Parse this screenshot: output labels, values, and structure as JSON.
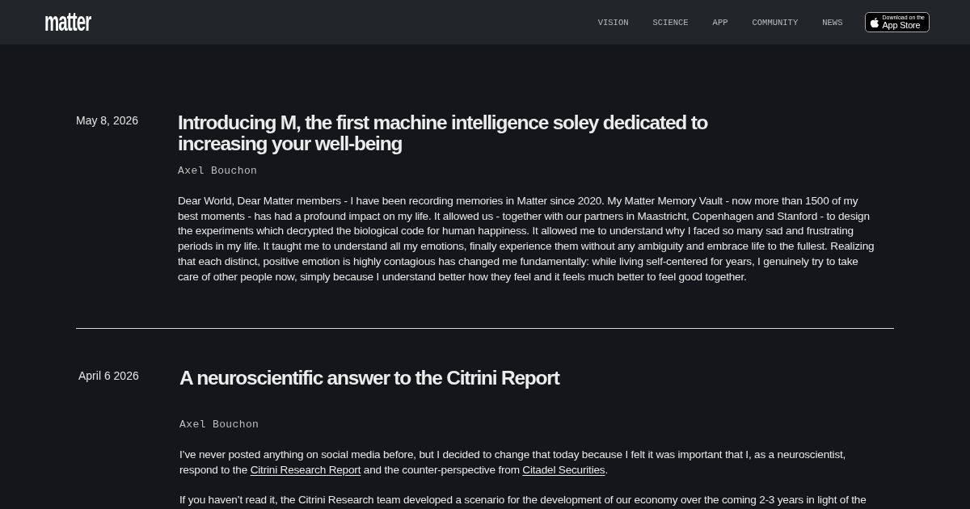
{
  "header": {
    "logo": "matter",
    "nav": [
      {
        "label": "VISION"
      },
      {
        "label": "SCIENCE"
      },
      {
        "label": "APP"
      },
      {
        "label": "COMMUNITY"
      },
      {
        "label": "NEWS"
      }
    ],
    "app_store_badge": {
      "small_text": "Download on the",
      "large_text": "App Store"
    }
  },
  "articles": [
    {
      "date": "May 8, 2026",
      "title": "Introducing M, the first machine intelligence soley dedicated to increasing your well-being",
      "author": "Axel Bouchon",
      "paragraphs": [
        {
          "segments": [
            {
              "kind": "text",
              "text": "Dear World, Dear Matter members -  I have been recording memories in Matter since 2020. My Matter Memory Vault - now more than 1500 of my best moments - has had a profound impact on my life. It allowed us -  together with our partners in Maastricht, Copenhagen and Stanford - to design the experiments which decrypted the biological code for human happiness. It allowed me to understand why I faced so many sad and frustrating periods in my life. It taught me to understand all my emotions, finally experience them without any ambiguity and embrace life to the fullest. Realizing that each distinct, positive emotion is highly contagious has changed me fundamentally: while living self-centered for years, I genuinely try to take care of other people now, simply because I understand better how they feel and it feels much better to feel good together."
            }
          ]
        }
      ]
    },
    {
      "date": "April 6 2026",
      "title": "A neuroscientific answer to the Citrini Report",
      "author": "Axel Bouchon",
      "paragraphs": [
        {
          "segments": [
            {
              "kind": "text",
              "text": "I’ve never posted anything on social media before, but I decided to change that today because I felt it was important that I, as a neuroscientist, respond to the "
            },
            {
              "kind": "link",
              "text": "Citrini Research Report"
            },
            {
              "kind": "text",
              "text": " and the counter-perspective from "
            },
            {
              "kind": "link",
              "text": "Citadel Securities"
            },
            {
              "kind": "text",
              "text": "."
            }
          ]
        },
        {
          "segments": [
            {
              "kind": "text",
              "text": "If you haven’t read it, the Citrini Research team developed a scenario for the development of our economy over the coming 2-3 years in light of the"
            }
          ]
        }
      ]
    }
  ]
}
